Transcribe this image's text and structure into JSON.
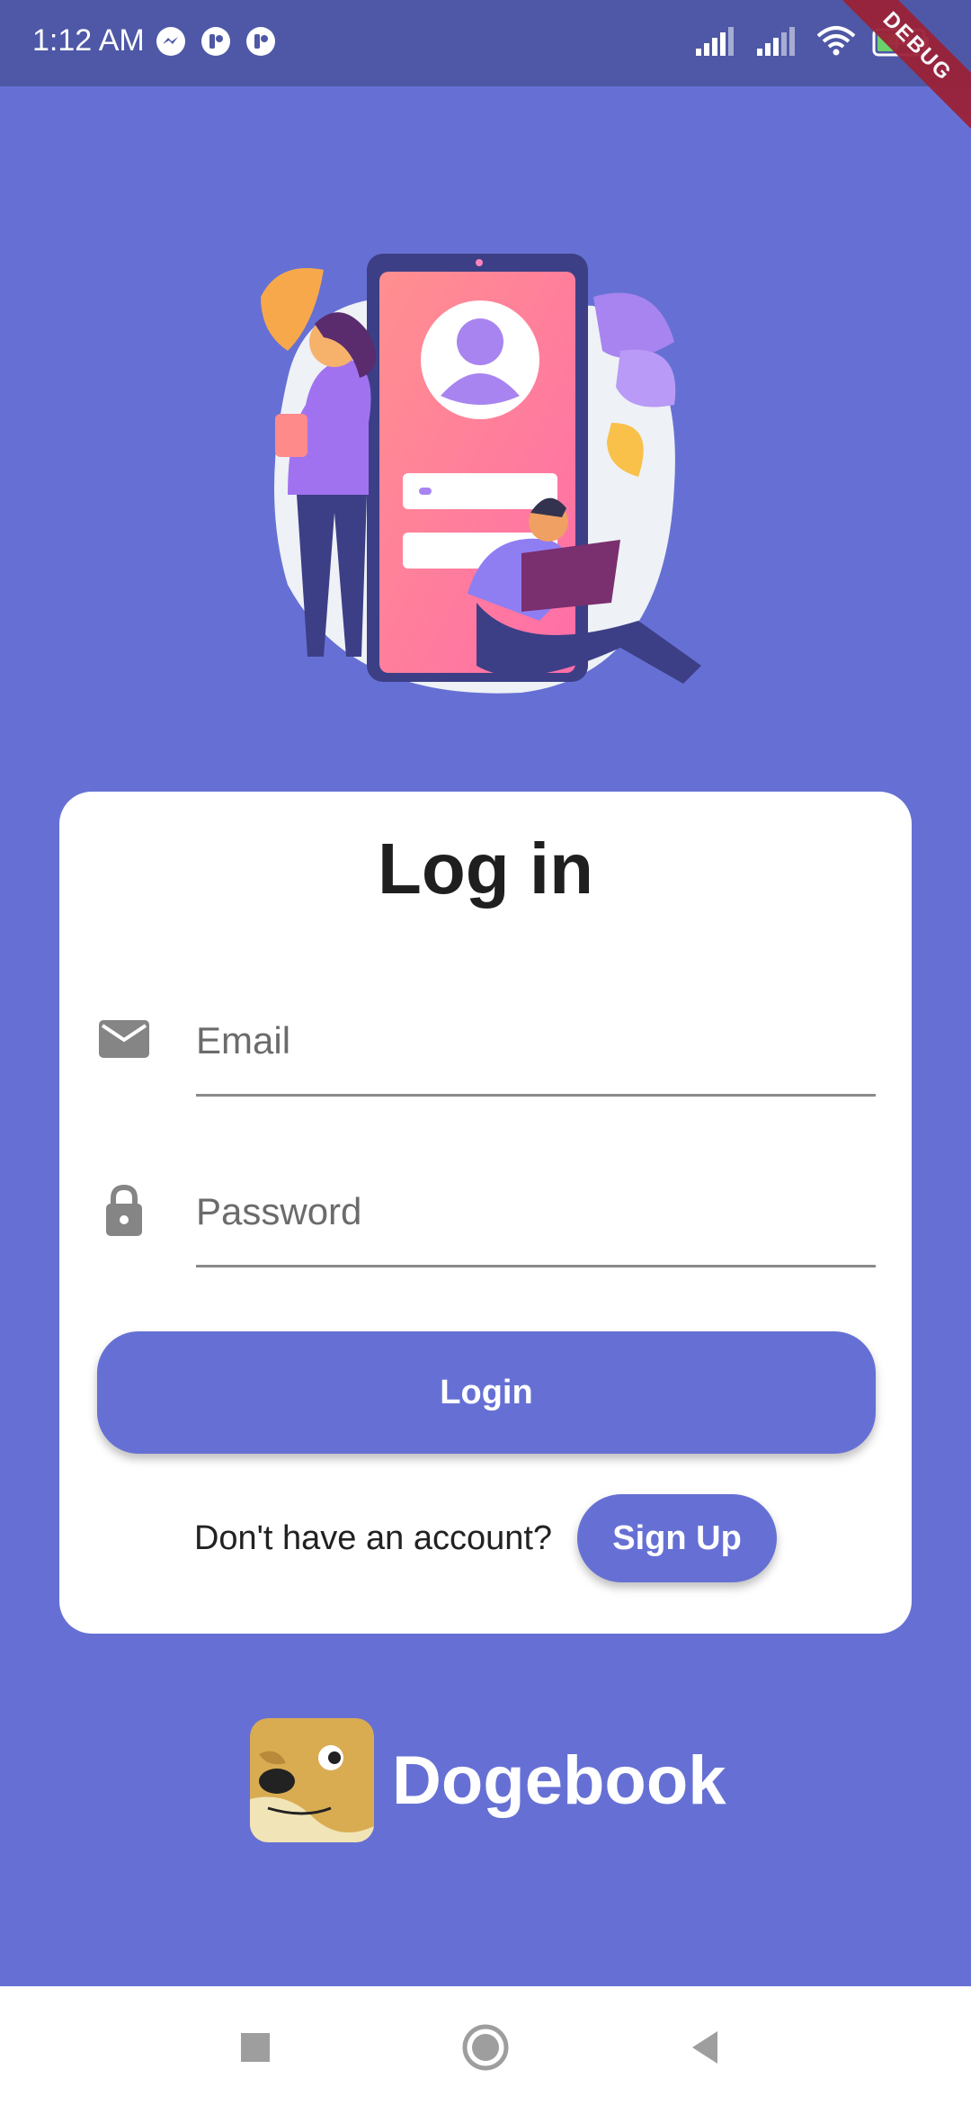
{
  "status_bar": {
    "time": "1:12 AM",
    "battery_level": "44",
    "debug_label": "DEBUG",
    "left_icons": [
      "messenger-icon",
      "app-icon",
      "app-icon"
    ],
    "right_icons": [
      "signal-icon",
      "signal-icon",
      "wifi-icon",
      "battery-icon"
    ]
  },
  "login": {
    "title": "Log in",
    "email_placeholder": "Email",
    "password_placeholder": "Password",
    "login_button": "Login",
    "no_account_text": "Don't have an account?",
    "signup_button": "Sign Up"
  },
  "brand": {
    "name": "Dogebook"
  },
  "nav": {
    "buttons": [
      "recents-button",
      "home-button",
      "back-button"
    ]
  },
  "colors": {
    "background": "#6670d4",
    "status_bar": "#4e58a6",
    "card": "#ffffff",
    "button": "#6670d4"
  }
}
